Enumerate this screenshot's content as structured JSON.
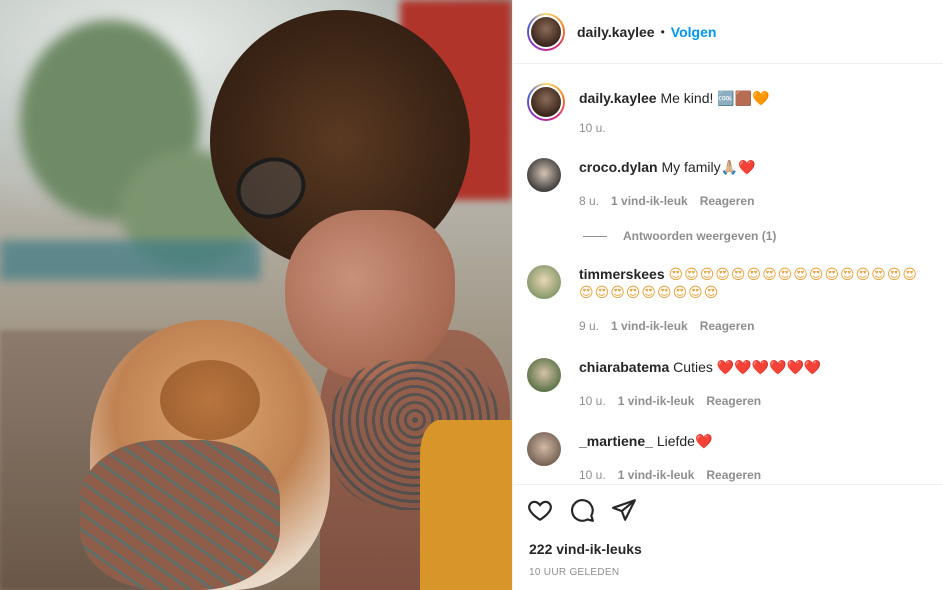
{
  "post": {
    "username": "daily.kaylee",
    "separator": "•",
    "follow_label": "Volgen",
    "caption": {
      "username": "daily.kaylee",
      "text": "Me kind! ",
      "emoji": "🆒🟫🧡",
      "time": "10 u."
    },
    "comments": [
      {
        "username": "croco.dylan",
        "text": "My family",
        "emoji": "🙏🏼❤️",
        "time": "8 u.",
        "likes": "1 vind-ik-leuk",
        "reply": "Reageren"
      },
      {
        "username": "timmerskees",
        "text": "",
        "emoji": "😍😍😍😍😍😍😍😍😍😍😍😍😍😍😍😍😍😍😍😍😍😍😍😍😍",
        "time": "9 u.",
        "likes": "1 vind-ik-leuk",
        "reply": "Reageren"
      },
      {
        "username": "chiarabatema",
        "text": "Cuties ",
        "emoji": "❤️❤️❤️❤️❤️❤️",
        "time": "10 u.",
        "likes": "1 vind-ik-leuk",
        "reply": "Reageren"
      },
      {
        "username": "_martiene_",
        "text": "Liefde",
        "emoji": "❤️",
        "time": "10 u.",
        "likes": "1 vind-ik-leuk",
        "reply": "Reageren"
      }
    ],
    "view_replies": "Antwoorden weergeven (1)",
    "like_count": "222 vind-ik-leuks",
    "posted": "10 uur geleden"
  },
  "icons": {
    "like": "heart-icon",
    "comment": "speech-bubble-icon",
    "share": "paper-plane-icon"
  },
  "colors": {
    "accent": "#0095f6",
    "text": "#262626",
    "muted": "#8e8e8e"
  }
}
